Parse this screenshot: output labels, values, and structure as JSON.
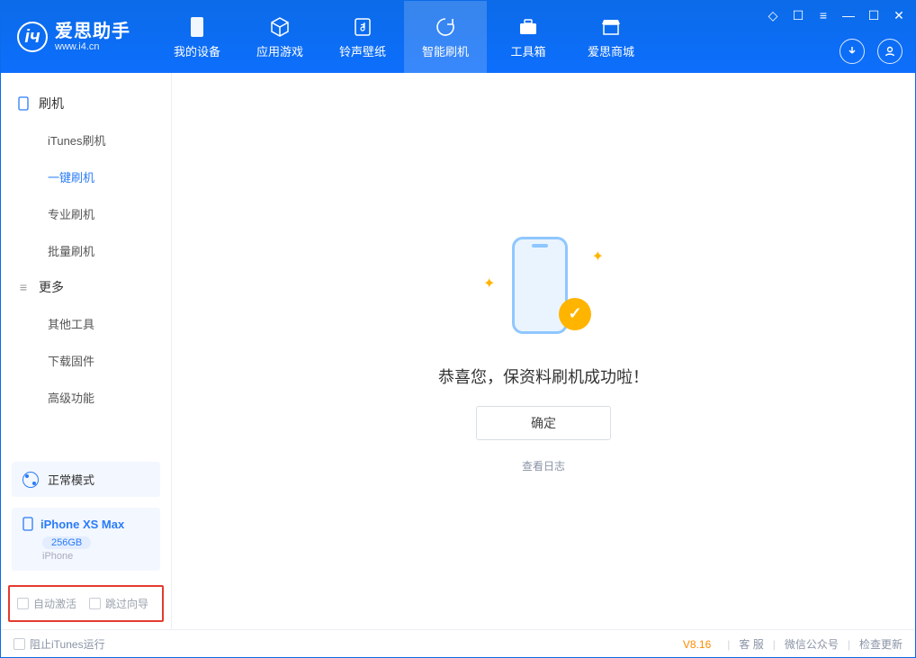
{
  "app": {
    "name": "爱思助手",
    "website": "www.i4.cn"
  },
  "header_tabs": [
    {
      "label": "我的设备",
      "icon": "device"
    },
    {
      "label": "应用游戏",
      "icon": "cube"
    },
    {
      "label": "铃声壁纸",
      "icon": "music"
    },
    {
      "label": "智能刷机",
      "icon": "refresh",
      "active": true
    },
    {
      "label": "工具箱",
      "icon": "toolbox"
    },
    {
      "label": "爱思商城",
      "icon": "shop"
    }
  ],
  "sidebar": {
    "group_flash": {
      "label": "刷机",
      "items": [
        "iTunes刷机",
        "一键刷机",
        "专业刷机",
        "批量刷机"
      ],
      "active_index": 1
    },
    "group_more": {
      "label": "更多",
      "items": [
        "其他工具",
        "下载固件",
        "高级功能"
      ]
    }
  },
  "mode": {
    "label": "正常模式"
  },
  "device": {
    "name": "iPhone XS Max",
    "storage": "256GB",
    "type": "iPhone"
  },
  "options": {
    "auto_activate": "自动激活",
    "skip_guide": "跳过向导"
  },
  "main": {
    "success_text": "恭喜您，保资料刷机成功啦！",
    "ok_label": "确定",
    "log_link": "查看日志"
  },
  "footer": {
    "block_itunes": "阻止iTunes运行",
    "version": "V8.16",
    "links": [
      "客 服",
      "微信公众号",
      "检查更新"
    ]
  }
}
